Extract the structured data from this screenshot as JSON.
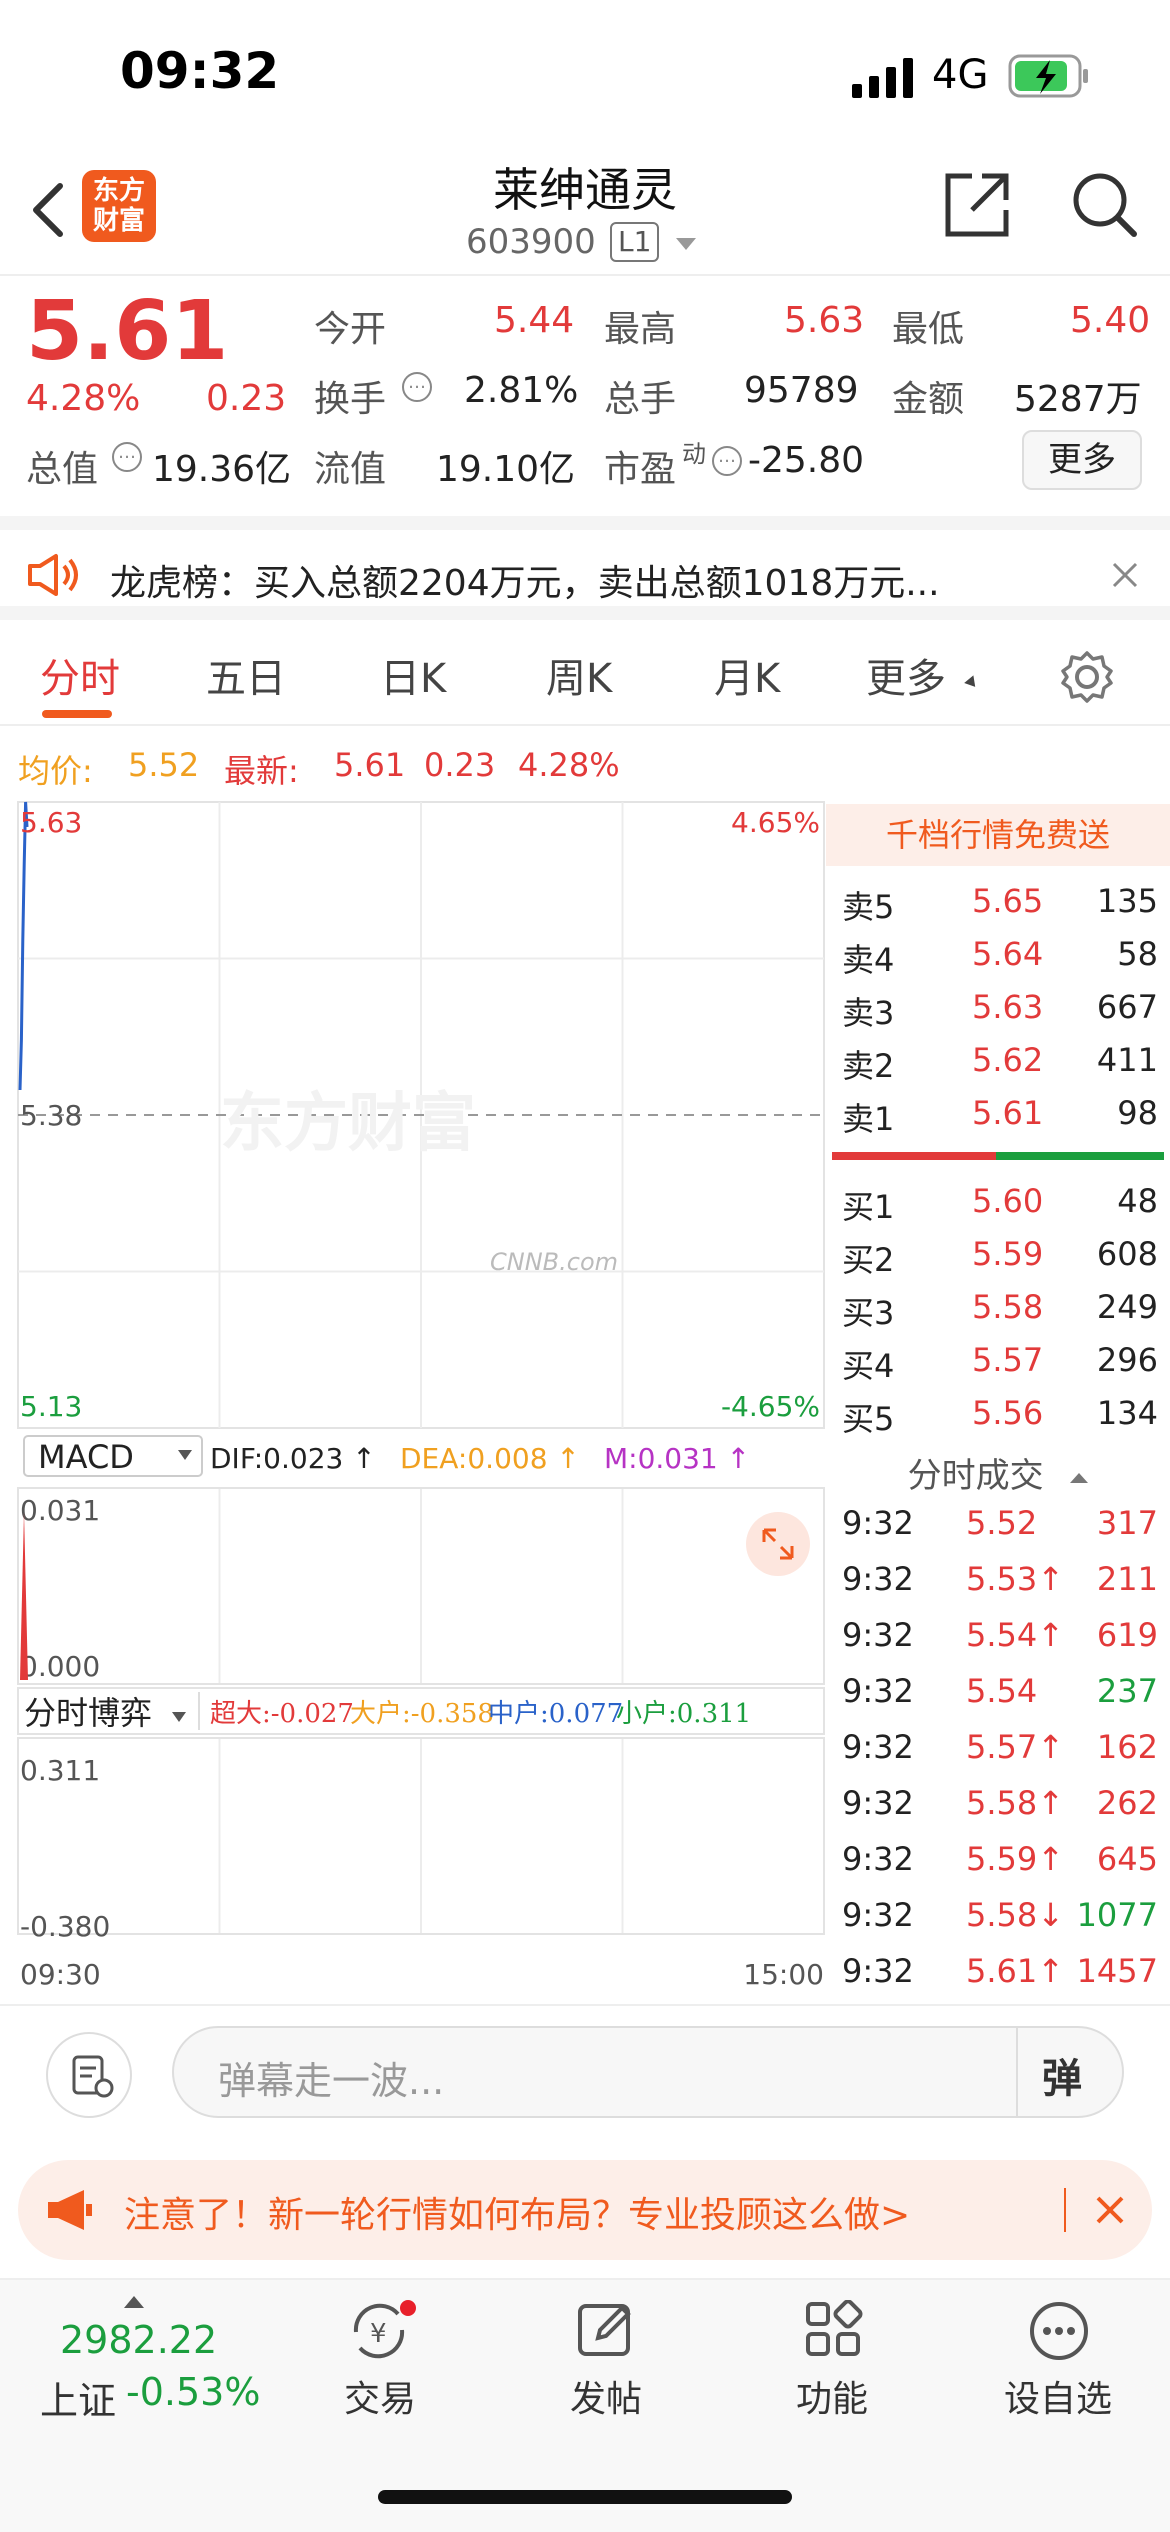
{
  "status": {
    "time": "09:32",
    "network": "4G"
  },
  "header": {
    "name": "莱绅通灵",
    "code": "603900",
    "level": "L1",
    "logo_text_1": "东方",
    "logo_text_2": "财富"
  },
  "quote": {
    "price": "5.61",
    "change_pct": "4.28%",
    "change": "0.23",
    "open_label": "今开",
    "open": "5.44",
    "high_label": "最高",
    "high": "5.63",
    "low_label": "最低",
    "low": "5.40",
    "turnover_label": "换手",
    "turnover": "2.81%",
    "volume_label": "总手",
    "volume": "95789",
    "amount_label": "金额",
    "amount": "5287万",
    "mktcap_label": "总值",
    "mktcap": "19.36亿",
    "float_label": "流值",
    "float": "19.10亿",
    "pe_label": "市盈",
    "pe_sup": "动",
    "pe": "-25.80",
    "more": "更多"
  },
  "notice": {
    "text": "龙虎榜：买入总额2204万元，卖出总额1018万元..."
  },
  "tabs": [
    "分时",
    "五日",
    "日K",
    "周K",
    "月K",
    "更多"
  ],
  "avgline": {
    "avg_label": "均价:",
    "avg": "5.52",
    "latest_label": "最新:",
    "latest": "5.61",
    "chg": "0.23",
    "pct": "4.28%"
  },
  "chart_data": {
    "type": "line",
    "title": "",
    "xlabel": "",
    "ylabel": "",
    "x_ticks": [
      "09:30",
      "15:00"
    ],
    "y_ticks_left": [
      "5.63",
      "5.38",
      "5.13"
    ],
    "y_ticks_right": [
      "4.65%",
      "-4.65%"
    ],
    "ylim": [
      5.13,
      5.63
    ],
    "prev_close": 5.38,
    "series": [
      {
        "values": [
          5.4,
          5.44,
          5.52,
          5.58,
          5.63,
          5.61
        ]
      }
    ],
    "watermark": "东方财富"
  },
  "macd": {
    "label": "MACD",
    "dif": "DIF:0.023 ↑",
    "dea": "DEA:0.008 ↑",
    "m": "M:0.031 ↑",
    "top": "0.031",
    "bottom": "0.000"
  },
  "flow": {
    "label": "分时博弈",
    "super": "超大:-0.027",
    "big": "大户:-0.358",
    "mid": "中户:0.077",
    "small": "小户:0.311",
    "top": "0.311",
    "bottom": "-0.380"
  },
  "orderbook": {
    "promo": "千档行情免费送",
    "asks": [
      {
        "label": "卖5",
        "price": "5.65",
        "vol": "135"
      },
      {
        "label": "卖4",
        "price": "5.64",
        "vol": "58"
      },
      {
        "label": "卖3",
        "price": "5.63",
        "vol": "667"
      },
      {
        "label": "卖2",
        "price": "5.62",
        "vol": "411"
      },
      {
        "label": "卖1",
        "price": "5.61",
        "vol": "98"
      }
    ],
    "bids": [
      {
        "label": "买1",
        "price": "5.60",
        "vol": "48"
      },
      {
        "label": "买2",
        "price": "5.59",
        "vol": "608"
      },
      {
        "label": "买3",
        "price": "5.58",
        "vol": "249"
      },
      {
        "label": "买4",
        "price": "5.57",
        "vol": "296"
      },
      {
        "label": "买5",
        "price": "5.56",
        "vol": "134"
      }
    ],
    "trades_title": "分时成交",
    "trades": [
      {
        "time": "9:32",
        "price": "5.52",
        "vol": "317",
        "color": "red"
      },
      {
        "time": "9:32",
        "price": "5.53↑",
        "vol": "211",
        "color": "red"
      },
      {
        "time": "9:32",
        "price": "5.54↑",
        "vol": "619",
        "color": "red"
      },
      {
        "time": "9:32",
        "price": "5.54",
        "vol": "237",
        "color": "green"
      },
      {
        "time": "9:32",
        "price": "5.57↑",
        "vol": "162",
        "color": "red"
      },
      {
        "time": "9:32",
        "price": "5.58↑",
        "vol": "262",
        "color": "red"
      },
      {
        "time": "9:32",
        "price": "5.59↑",
        "vol": "645",
        "color": "red"
      },
      {
        "time": "9:32",
        "price": "5.58↓",
        "vol": "1077",
        "color": "green"
      },
      {
        "time": "9:32",
        "price": "5.61↑",
        "vol": "1457",
        "color": "red"
      }
    ]
  },
  "comment": {
    "placeholder": "弹幕走一波...",
    "danmu": "弹"
  },
  "ad": {
    "text": "注意了！新一轮行情如何布局？专业投顾这么做>"
  },
  "nav": {
    "index_value": "2982.22",
    "index_name": "上证",
    "index_pct": "-0.53%",
    "items": [
      "交易",
      "发帖",
      "功能",
      "设自选"
    ]
  },
  "colors": {
    "up": "#e23a3a",
    "down": "#1b9e3e",
    "brand": "#f05a1e"
  }
}
